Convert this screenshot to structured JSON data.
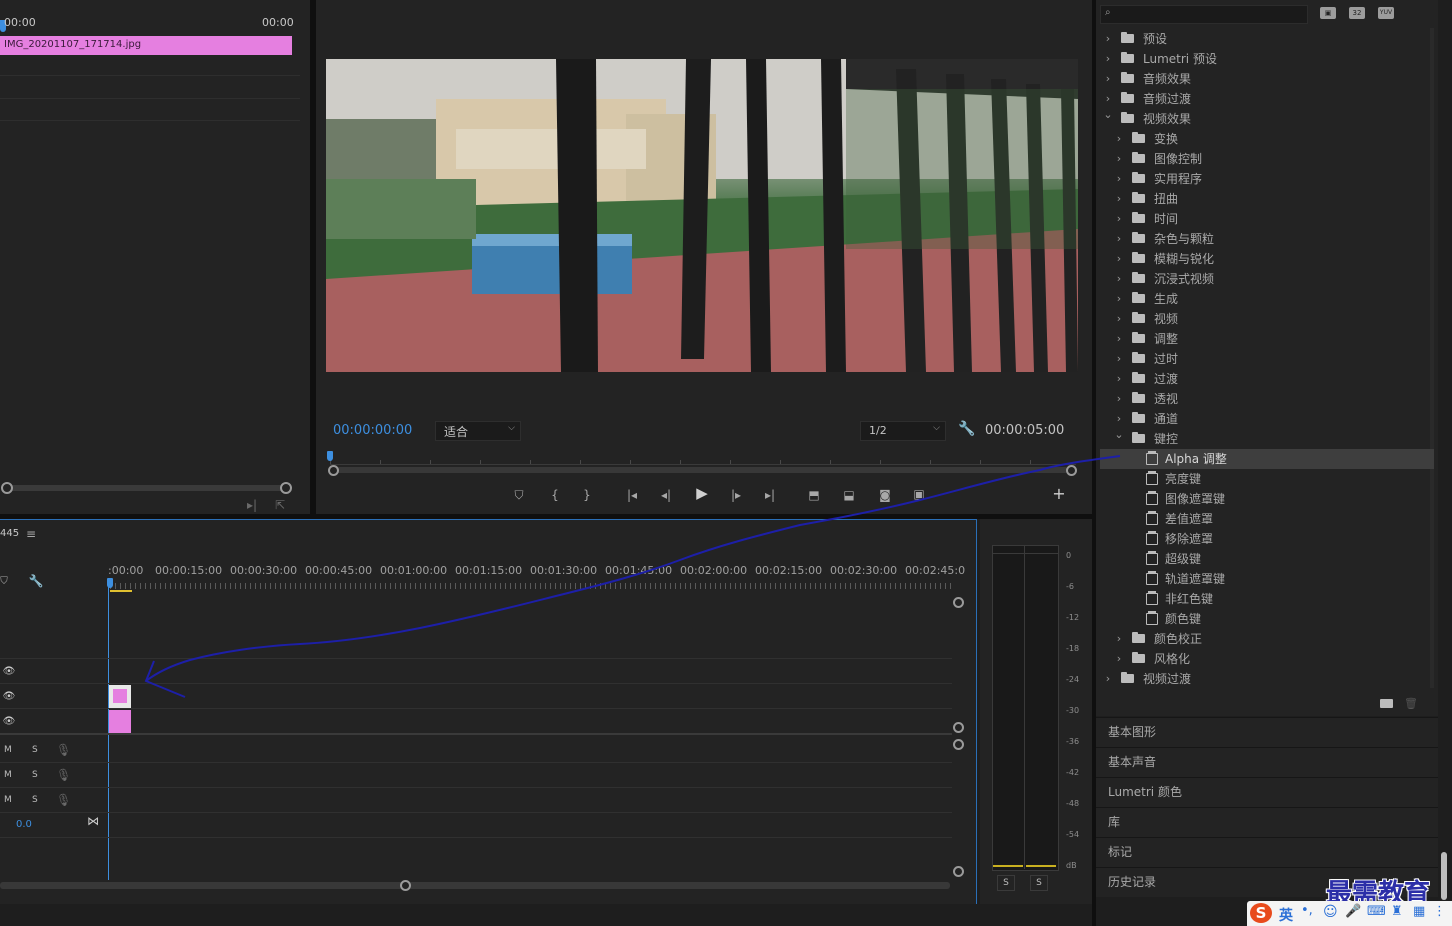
{
  "source_monitor": {
    "timecode_start": "00:00",
    "timecode_end": "00:00",
    "clip_name": "IMG_20201107_171714.jpg"
  },
  "program_monitor": {
    "current_time": "00:00:00:00",
    "zoom_select": "适合",
    "resolution_select": "1/2",
    "duration": "00:00:05:00"
  },
  "effects_panel": {
    "search_placeholder": "",
    "badges": [
      "32",
      "YUV"
    ],
    "tree": [
      {
        "label": "预设",
        "level": 0,
        "expanded": false,
        "icon": "preset-folder"
      },
      {
        "label": "Lumetri 预设",
        "level": 0,
        "expanded": false,
        "icon": "preset-folder"
      },
      {
        "label": "音频效果",
        "level": 0,
        "expanded": false,
        "icon": "folder"
      },
      {
        "label": "音频过渡",
        "level": 0,
        "expanded": false,
        "icon": "folder"
      },
      {
        "label": "视频效果",
        "level": 0,
        "expanded": true,
        "icon": "folder"
      },
      {
        "label": "变换",
        "level": 1,
        "expanded": false,
        "icon": "folder"
      },
      {
        "label": "图像控制",
        "level": 1,
        "expanded": false,
        "icon": "folder"
      },
      {
        "label": "实用程序",
        "level": 1,
        "expanded": false,
        "icon": "folder"
      },
      {
        "label": "扭曲",
        "level": 1,
        "expanded": false,
        "icon": "folder"
      },
      {
        "label": "时间",
        "level": 1,
        "expanded": false,
        "icon": "folder"
      },
      {
        "label": "杂色与颗粒",
        "level": 1,
        "expanded": false,
        "icon": "folder"
      },
      {
        "label": "模糊与锐化",
        "level": 1,
        "expanded": false,
        "icon": "folder"
      },
      {
        "label": "沉浸式视频",
        "level": 1,
        "expanded": false,
        "icon": "folder"
      },
      {
        "label": "生成",
        "level": 1,
        "expanded": false,
        "icon": "folder"
      },
      {
        "label": "视频",
        "level": 1,
        "expanded": false,
        "icon": "folder"
      },
      {
        "label": "调整",
        "level": 1,
        "expanded": false,
        "icon": "folder"
      },
      {
        "label": "过时",
        "level": 1,
        "expanded": false,
        "icon": "folder"
      },
      {
        "label": "过渡",
        "level": 1,
        "expanded": false,
        "icon": "folder"
      },
      {
        "label": "透视",
        "level": 1,
        "expanded": false,
        "icon": "folder"
      },
      {
        "label": "通道",
        "level": 1,
        "expanded": false,
        "icon": "folder"
      },
      {
        "label": "键控",
        "level": 1,
        "expanded": true,
        "icon": "folder"
      },
      {
        "label": "Alpha 调整",
        "level": 2,
        "selected": true,
        "icon": "effect"
      },
      {
        "label": "亮度键",
        "level": 2,
        "icon": "effect"
      },
      {
        "label": "图像遮罩键",
        "level": 2,
        "icon": "effect"
      },
      {
        "label": "差值遮罩",
        "level": 2,
        "icon": "effect"
      },
      {
        "label": "移除遮罩",
        "level": 2,
        "icon": "effect"
      },
      {
        "label": "超级键",
        "level": 2,
        "icon": "effect"
      },
      {
        "label": "轨道遮罩键",
        "level": 2,
        "icon": "effect"
      },
      {
        "label": "非红色键",
        "level": 2,
        "icon": "effect"
      },
      {
        "label": "颜色键",
        "level": 2,
        "icon": "effect"
      },
      {
        "label": "颜色校正",
        "level": 1,
        "expanded": false,
        "icon": "folder"
      },
      {
        "label": "风格化",
        "level": 1,
        "expanded": false,
        "icon": "folder"
      },
      {
        "label": "视频过渡",
        "level": 0,
        "expanded": false,
        "icon": "folder"
      }
    ]
  },
  "side_sections": [
    "基本图形",
    "基本声音",
    "Lumetri 颜色",
    "库",
    "标记",
    "历史记录"
  ],
  "timeline": {
    "sequence_name_partial": "445",
    "ruler_labels": [
      ":00:00",
      "00:00:15:00",
      "00:00:30:00",
      "00:00:45:00",
      "00:01:00:00",
      "00:01:15:00",
      "00:01:30:00",
      "00:01:45:00",
      "00:02:00:00",
      "00:02:15:00",
      "00:02:30:00",
      "00:02:45:0"
    ],
    "audio_track_labels": {
      "m": "M",
      "s": "S"
    },
    "master_volume": "0.0"
  },
  "audio_meter": {
    "scale": [
      "0",
      "-6",
      "-12",
      "-18",
      "-24",
      "-30",
      "-36",
      "-42",
      "-48",
      "-54",
      "dB"
    ],
    "solo_labels": [
      "S",
      "S"
    ]
  },
  "watermark": {
    "text": "最需教育"
  },
  "ime_bar": {
    "lang_label": "英"
  },
  "colors": {
    "accent_blue": "#3d8fe0",
    "clip_pink": "#e57fe0",
    "annotation_arrow": "#1d1fa8",
    "selected_row": "#3e3e3e"
  }
}
